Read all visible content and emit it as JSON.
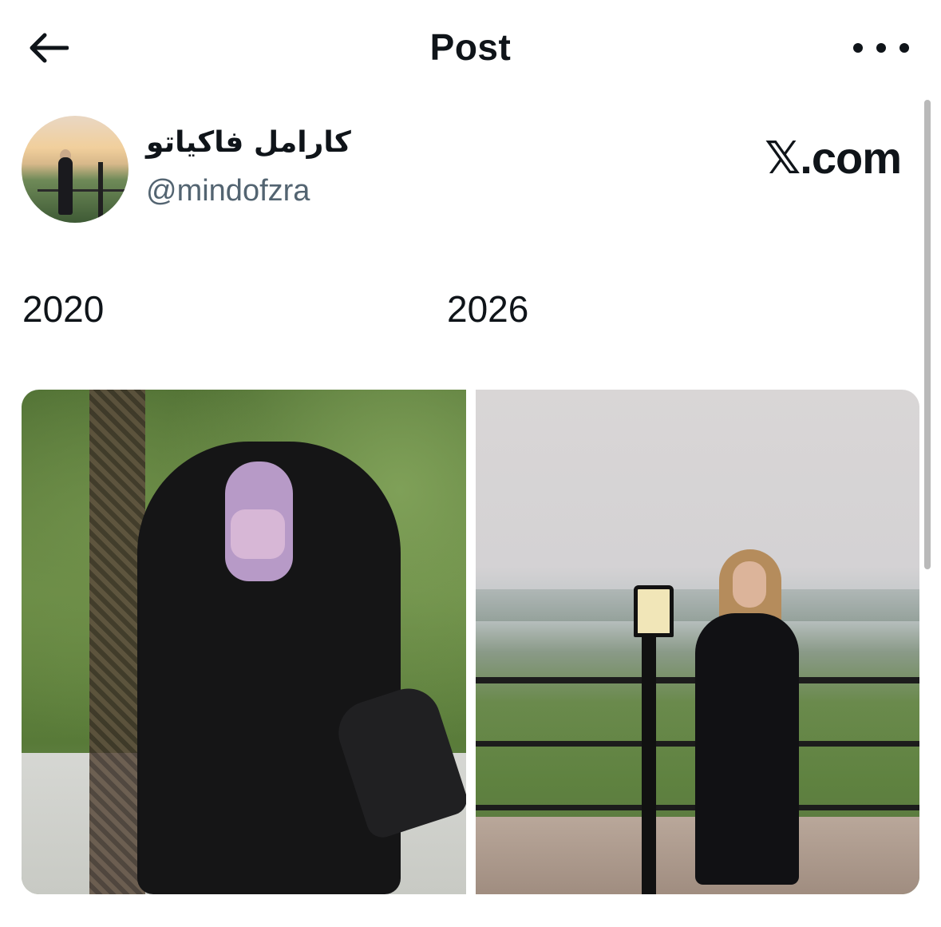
{
  "header": {
    "title": "Post",
    "back_icon": "arrow-left-icon",
    "more_icon": "more-horizontal-icon"
  },
  "post": {
    "author": {
      "display_name": "كارامل فاكياتو",
      "handle": "@mindofzra"
    },
    "watermark": "𝕏.com",
    "text": {
      "left_label": "2020",
      "right_label": "2026"
    },
    "media": [
      {
        "name": "photo-2020"
      },
      {
        "name": "photo-2026"
      }
    ]
  },
  "colors": {
    "text_primary": "#0f1419",
    "text_secondary": "#536471",
    "background": "#ffffff",
    "scrollbar": "#b9b9b9"
  }
}
